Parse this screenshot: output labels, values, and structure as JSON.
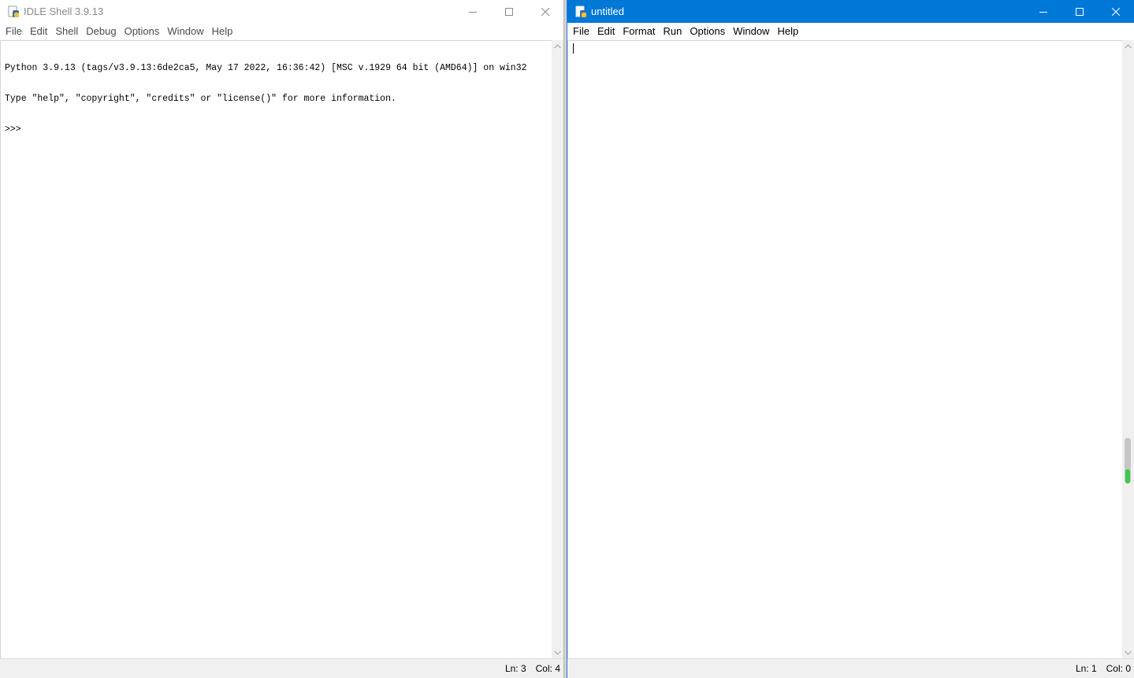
{
  "shell": {
    "title": "IDLE Shell 3.9.13",
    "menu": [
      "File",
      "Edit",
      "Shell",
      "Debug",
      "Options",
      "Window",
      "Help"
    ],
    "lines": [
      "Python 3.9.13 (tags/v3.9.13:6de2ca5, May 17 2022, 16:36:42) [MSC v.1929 64 bit (AMD64)] on win32",
      "Type \"help\", \"copyright\", \"credits\" or \"license()\" for more information.",
      ">>> "
    ],
    "status": {
      "line": "Ln: 3",
      "col": "Col: 4"
    }
  },
  "editor": {
    "title": "untitled",
    "menu": [
      "File",
      "Edit",
      "Format",
      "Run",
      "Options",
      "Window",
      "Help"
    ],
    "status": {
      "line": "Ln: 1",
      "col": "Col: 0"
    }
  },
  "icons": {
    "app": "python-idle-icon",
    "minimize": "minimize-icon",
    "maximize": "maximize-icon",
    "close": "close-icon",
    "scroll_up": "scroll-up-arrow-icon",
    "scroll_down": "scroll-down-arrow-icon"
  },
  "colors": {
    "editor_titlebar": "#0078d7",
    "inactive_title_text": "#8a8a8a",
    "status_background": "#f0f0f0"
  }
}
